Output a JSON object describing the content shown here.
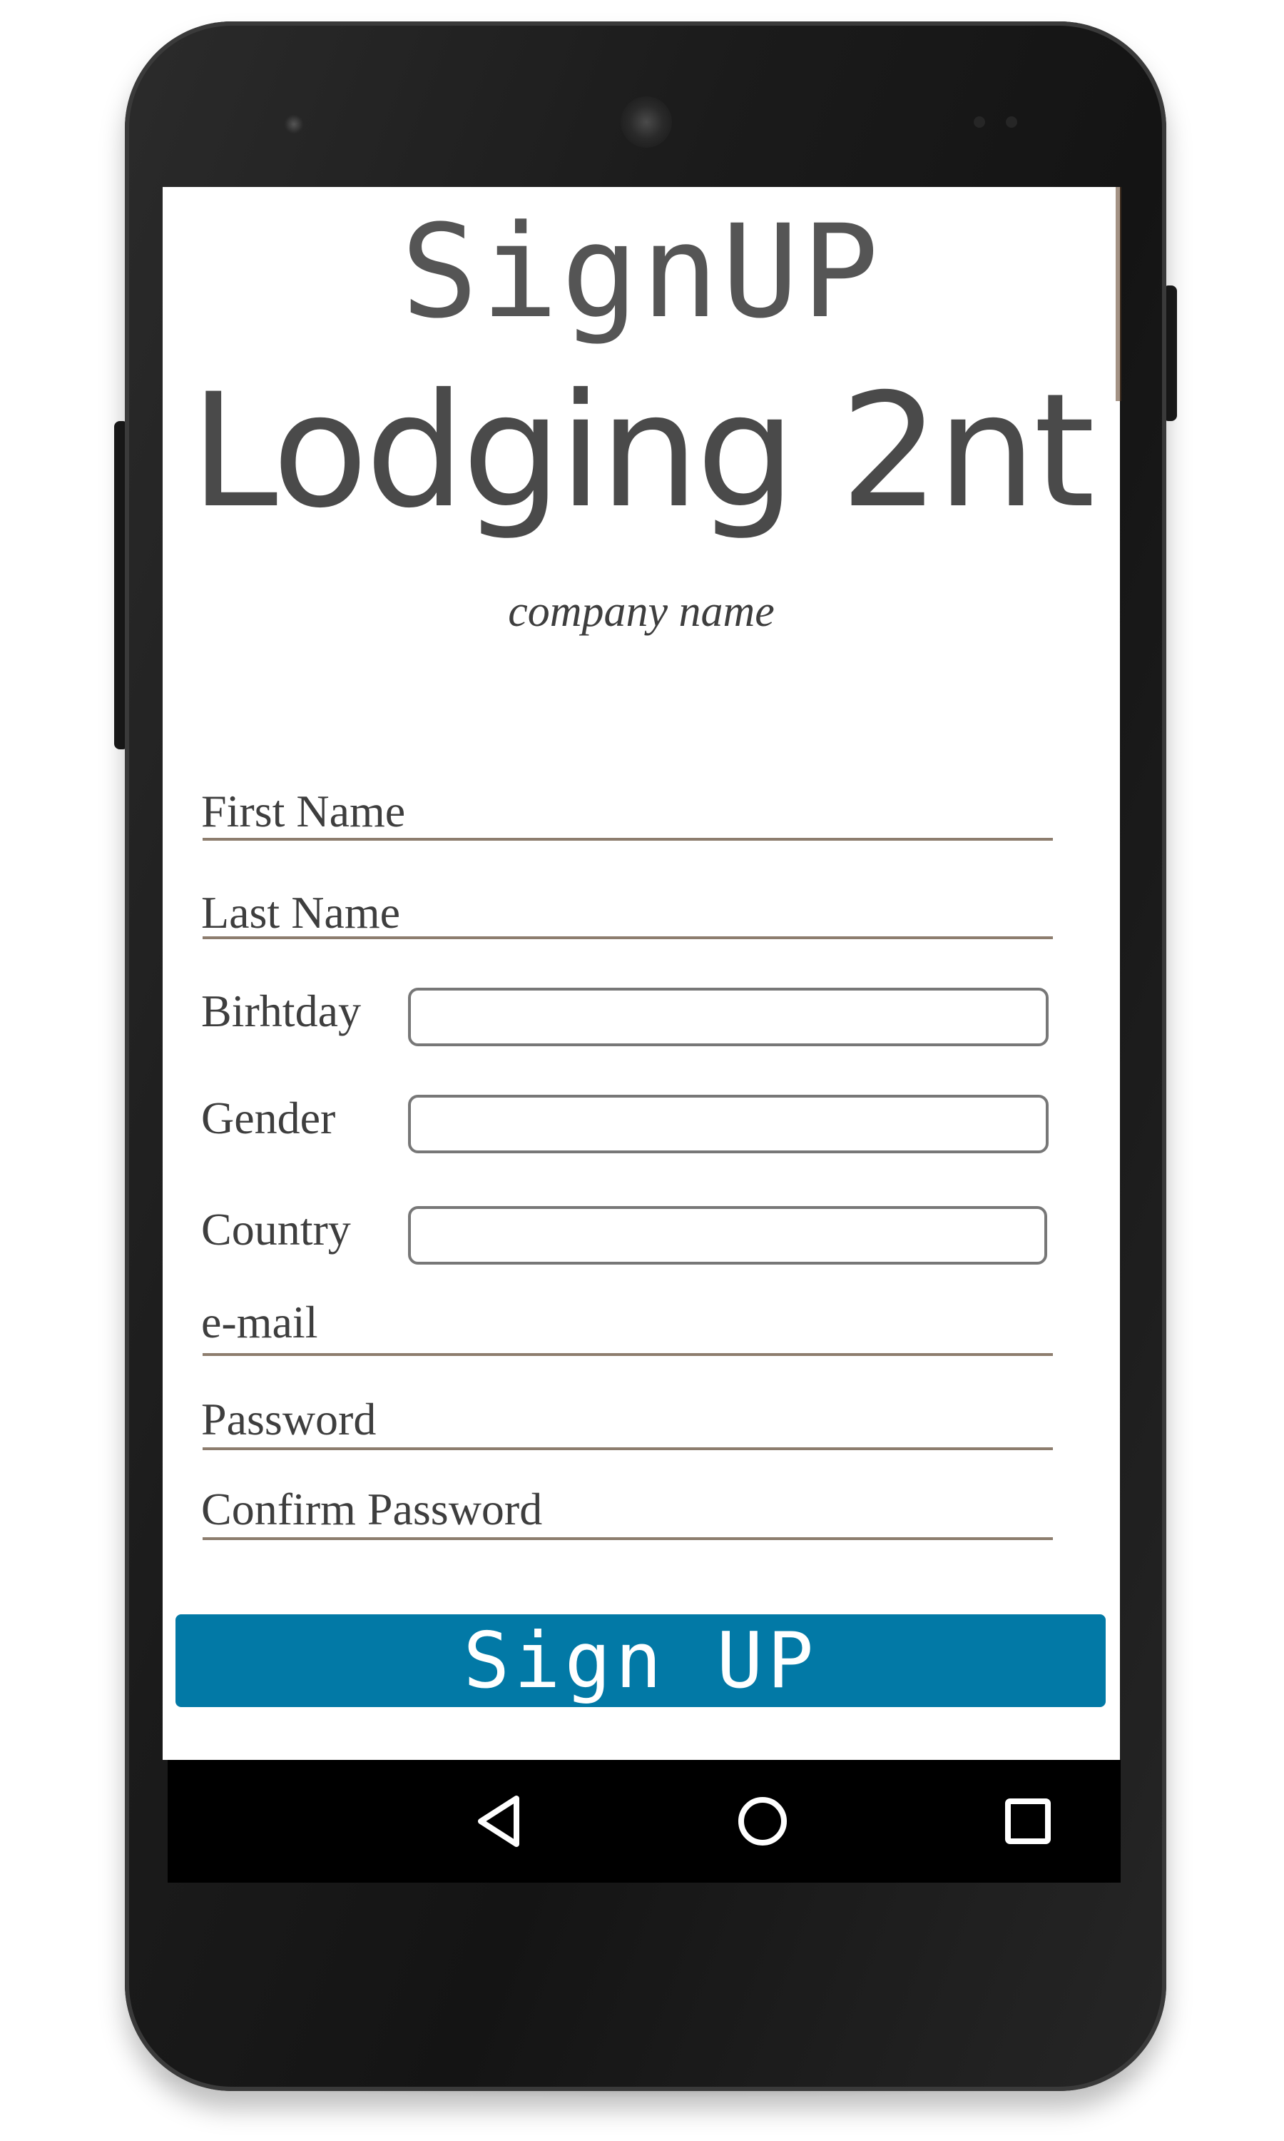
{
  "header": {
    "title": "SignUP",
    "brand_name": "Lodging 2nt",
    "tagline": "company name"
  },
  "form": {
    "first_name_label": "First Name",
    "last_name_label": "Last Name",
    "birthday_label": "Birhtday",
    "gender_label": "Gender",
    "country_label": "Country",
    "email_label": "e-mail",
    "password_label": "Password",
    "confirm_password_label": "Confirm Password",
    "birthday_value": "",
    "gender_value": "",
    "country_value": ""
  },
  "actions": {
    "signup_button_label": "Sign UP"
  },
  "navbar": {
    "icons": [
      "back-icon",
      "home-icon",
      "recents-icon"
    ]
  },
  "colors": {
    "button_bg": "#0279a6",
    "button_text": "#ffffff",
    "underline": "#8d7d6e",
    "text": "#3e3e3e"
  }
}
